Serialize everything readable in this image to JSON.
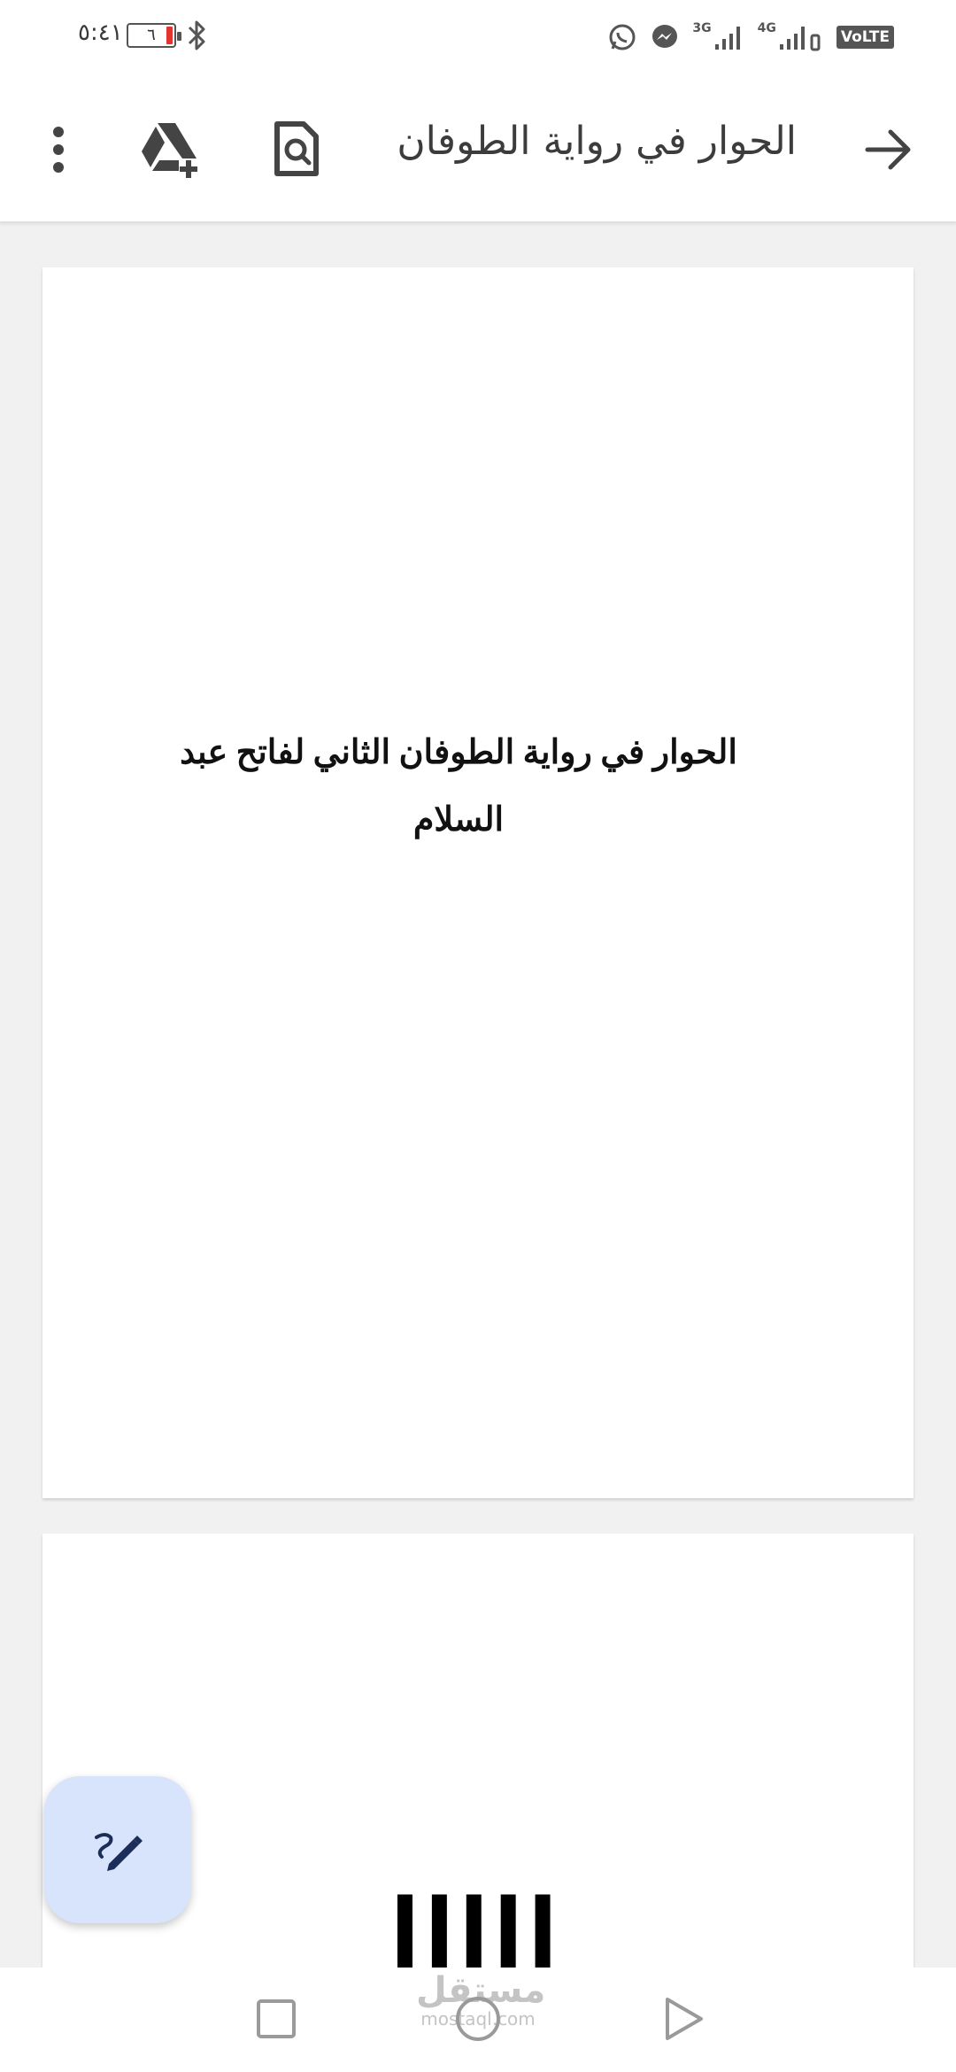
{
  "status_bar": {
    "time": "٥:٤١",
    "battery_level": "٦",
    "network_3g": "3G",
    "network_4g": "4G",
    "volte": "VoLTE"
  },
  "app_bar": {
    "title": "الحوار في رواية الطوفان"
  },
  "document": {
    "page1_title": "الحوار في رواية الطوفان الثاني لفاتح عبد السلام",
    "page2_text": "ااااا"
  },
  "watermark": {
    "arabic": "مستقل",
    "latin": "mostaql.com"
  },
  "colors": {
    "fab_background": "#d8e4fb",
    "battery_low": "#e3342f",
    "app_bar_text": "#3c3c3c"
  }
}
